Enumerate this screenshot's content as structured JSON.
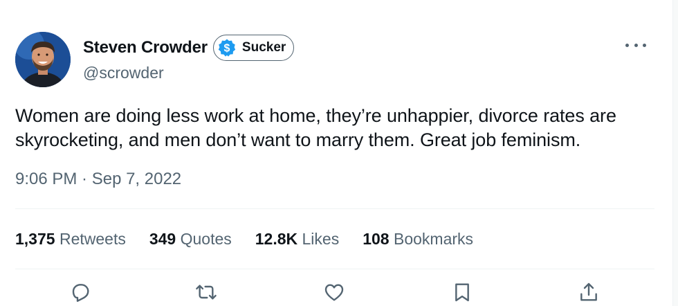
{
  "author": {
    "display_name": "Steven Crowder",
    "handle": "@scrowder",
    "label_text": "Sucker",
    "label_icon": "dollar-sign-badge-icon",
    "badge_color": "#1d9bf0"
  },
  "tweet": {
    "text": "Women are doing less work at home, they’re unhappier, divorce rates are skyrocketing, and men don’t want to marry them. Great job feminism.",
    "timestamp": "9:06 PM · Sep 7, 2022"
  },
  "stats": {
    "retweets_count": "1,375",
    "retweets_label": "Retweets",
    "quotes_count": "349",
    "quotes_label": "Quotes",
    "likes_count": "12.8K",
    "likes_label": "Likes",
    "bookmarks_count": "108",
    "bookmarks_label": "Bookmarks"
  },
  "actions": [
    "reply-icon",
    "retweet-icon",
    "like-icon",
    "bookmark-icon",
    "share-icon"
  ],
  "colors": {
    "text_primary": "#0f1419",
    "text_secondary": "#536471",
    "divider": "#eff3f4",
    "accent": "#1d9bf0"
  }
}
